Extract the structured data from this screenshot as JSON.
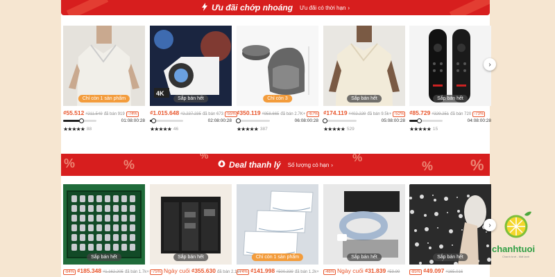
{
  "flash_banner": {
    "title": "Ưu đãi chớp nhoáng",
    "subtitle": "Ưu đãi có thời hạn"
  },
  "clearance_banner": {
    "title": "Deal thanh lý",
    "subtitle": "Số lượng có hạn"
  },
  "flash_products": [
    {
      "badge": "Chỉ còn 1 sản phẩm",
      "price": "₫55.512",
      "old": "₫211.549",
      "sold": "đã bán 919",
      "disc": "-74%",
      "timer": "01:08:00:28",
      "progress": 0.55,
      "rating_count": "88"
    },
    {
      "badge": "Sắp bán hết",
      "price": "₫1.015.648",
      "old": "₫2.237.235",
      "sold": "đã bán 673",
      "disc": "-55%",
      "timer": "02:08:00:28",
      "progress": 0.1,
      "rating_count": "46",
      "tag": "4K"
    },
    {
      "badge": "Chỉ còn 3",
      "price": "₫350.119",
      "old": "₫958.665",
      "sold": "đã bán 2.7K+",
      "disc": "-67%",
      "timer": "06:08:00:28",
      "progress": 0.05,
      "rating_count": "387"
    },
    {
      "badge": "Sắp bán hết",
      "price": "₫174.119",
      "old": "₫402.229",
      "sold": "đã bán 9.5k+",
      "disc": "-52%",
      "timer": "05:08:00:28",
      "progress": 0.05,
      "rating_count": "529"
    },
    {
      "badge": "Sắp bán hết",
      "price": "₫85.729",
      "old": "₫329.251",
      "sold": "đã bán 720",
      "disc": "-73%",
      "timer": "04:08:00:28",
      "progress": 0.3,
      "rating_count": "15"
    }
  ],
  "clearance_products": [
    {
      "badge": "Sắp bán hết",
      "prefix": "-84%",
      "price": "₫185.348",
      "old": "₫1.162.205",
      "sold": "đã bán 1.7k+"
    },
    {
      "badge": "Sắp bán hết",
      "prefix": "-75%",
      "label": "Ngày cuối",
      "price": "₫355.630",
      "sold": "đã bán 2.1k+"
    },
    {
      "badge": "Chỉ còn 1 sản phẩm",
      "prefix": "-74%",
      "price": "₫141.998",
      "old": "₫500.339",
      "sold": "đã bán 1.2k+"
    },
    {
      "badge": "Sắp bán hết",
      "prefix": "-46%",
      "label": "Ngày cuối",
      "price": "₫31.839",
      "old": "₫59.99"
    },
    {
      "badge": "Sắp bán hết",
      "prefix": "-85%",
      "price": "₫49.097",
      "old": "₫165.016"
    }
  ],
  "watermark": {
    "brand": "chanhtuoi",
    "tagline": "Chanh tươi - Mát lạnh"
  },
  "colors": {
    "red": "#d71e1e",
    "orange": "#e8542a"
  }
}
